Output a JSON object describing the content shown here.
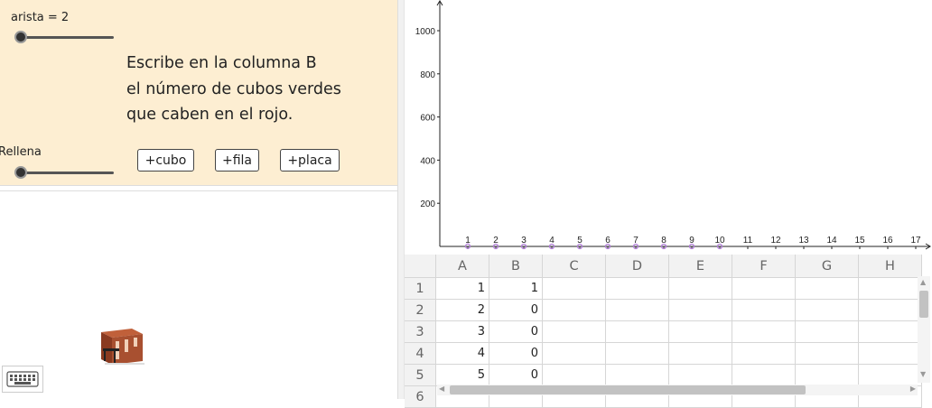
{
  "left_panel": {
    "slider_arista": {
      "label": "arista = 2",
      "value": 2
    },
    "slider_rellena": {
      "label": "Rellena"
    },
    "instructions": [
      "Escribe en la columna B",
      "el número de cubos verdes",
      "que caben en el rojo."
    ],
    "buttons": {
      "cubo": "+cubo",
      "fila": "+fila",
      "placa": "+placa"
    }
  },
  "graph": {
    "y_ticks": [
      "1000",
      "800",
      "600",
      "400",
      "200"
    ],
    "x_ticks": [
      "1",
      "2",
      "3",
      "4",
      "5",
      "6",
      "7",
      "8",
      "9",
      "10",
      "11",
      "12",
      "13",
      "14",
      "15",
      "16",
      "17"
    ],
    "point_color": "#b07cd8"
  },
  "chart_data": {
    "type": "scatter",
    "x": [
      1,
      2,
      3,
      4,
      5,
      6,
      7,
      8,
      9,
      10
    ],
    "y": [
      1,
      0,
      0,
      0,
      0,
      0,
      0,
      0,
      0,
      0
    ],
    "xlim": [
      0,
      17
    ],
    "ylim": [
      0,
      1000
    ]
  },
  "spreadsheet": {
    "columns": [
      "A",
      "B",
      "C",
      "D",
      "E",
      "F",
      "G",
      "H"
    ],
    "rows": [
      {
        "num": "1",
        "A": "1",
        "B": "1"
      },
      {
        "num": "2",
        "A": "2",
        "B": "0"
      },
      {
        "num": "3",
        "A": "3",
        "B": "0"
      },
      {
        "num": "4",
        "A": "4",
        "B": "0"
      },
      {
        "num": "5",
        "A": "5",
        "B": "0"
      },
      {
        "num": "6",
        "A": "",
        "B": ""
      }
    ]
  },
  "icons": {
    "keyboard": "keyboard-icon",
    "cube": "cube-icon"
  }
}
